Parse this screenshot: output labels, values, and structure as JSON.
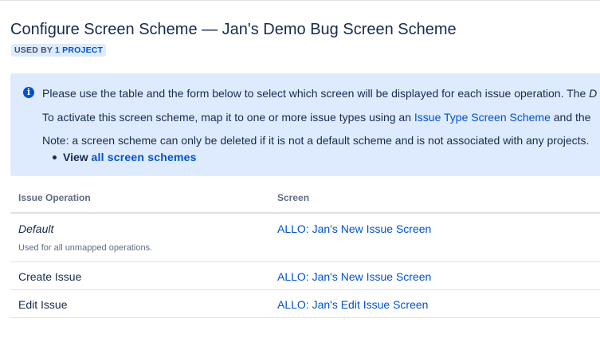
{
  "header": {
    "title": "Configure Screen Scheme — Jan's Demo Bug Screen Scheme",
    "badge_prefix": "USED BY",
    "badge_link": "1 PROJECT"
  },
  "info": {
    "icon": "info-icon",
    "line1_text": "Please use the table and the form below to select which screen will be displayed for each issue operation. The ",
    "line1_em": "D",
    "line2_text": "To activate this screen scheme, map it to one or more issue types using an ",
    "line2_link": "Issue Type Screen Scheme",
    "line2_suffix": " and the",
    "line3_text": "Note: a screen scheme can only be deleted if it is not a default scheme and is not associated with any projects.",
    "view_prefix": "View ",
    "view_link": "all screen schemes"
  },
  "table": {
    "columns": [
      "Issue Operation",
      "Screen"
    ],
    "rows": [
      {
        "operation": "Default",
        "description": "Used for all unmapped operations.",
        "screen": "ALLO: Jan's New Issue Screen"
      },
      {
        "operation": "Create Issue",
        "screen": "ALLO: Jan's New Issue Screen"
      },
      {
        "operation": "Edit Issue",
        "screen": "ALLO: Jan's Edit Issue Screen"
      }
    ]
  },
  "colors": {
    "link": "#0052cc",
    "info_bg": "#deebff",
    "text": "#172b4d",
    "muted": "#5e6c84"
  }
}
